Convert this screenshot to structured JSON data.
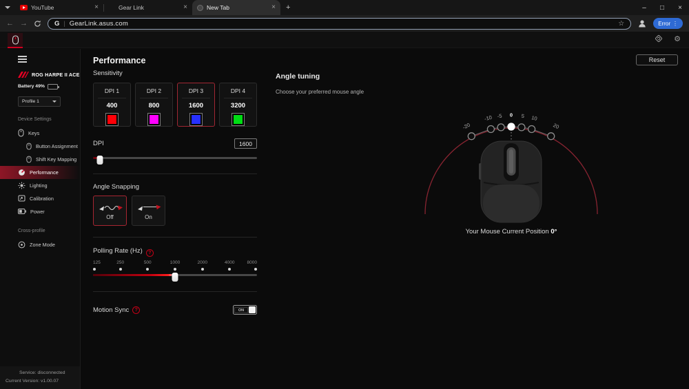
{
  "browser": {
    "tabs": [
      {
        "label": "YouTube"
      },
      {
        "label": "Gear Link"
      },
      {
        "label": "New Tab"
      }
    ],
    "url": "GearLink.asus.com",
    "url_favicon": "G",
    "error_label": "Error",
    "icons": {
      "back": "←",
      "forward": "→",
      "star": "☆",
      "more": "⋮",
      "new_tab": "+",
      "close_tab": "×",
      "minimize": "–",
      "maximize": "□",
      "close_window": "×"
    }
  },
  "app_header": {
    "icons": {
      "settings": "⚙"
    }
  },
  "sidebar": {
    "device_name": "ROG HARPE II ACE",
    "battery_label": "Battery 49%",
    "battery_level": "49%",
    "profile": "Profile 1",
    "section_device": "Device Settings",
    "section_cross": "Cross-profile",
    "items": {
      "keys": "Keys",
      "button_assignment": "Button Assignment",
      "shift_key_mapping": "Shift Key Mapping",
      "performance": "Performance",
      "lighting": "Lighting",
      "calibration": "Calibration",
      "power": "Power",
      "zone_mode": "Zone Mode"
    },
    "footer": {
      "service": "Service: disconnected",
      "version": "Current Version: v1.00.07"
    }
  },
  "performance": {
    "title": "Performance",
    "reset_label": "Reset",
    "sensitivity_label": "Sensitivity",
    "dpi_cards": [
      {
        "label": "DPI 1",
        "value": "400",
        "color": "#ff0008"
      },
      {
        "label": "DPI 2",
        "value": "800",
        "color": "#ff00ff"
      },
      {
        "label": "DPI 3",
        "value": "1600",
        "color": "#2730ff"
      },
      {
        "label": "DPI 4",
        "value": "3200",
        "color": "#00dc14"
      }
    ],
    "dpi_slider": {
      "label": "DPI",
      "value": "1600",
      "fill": "5%",
      "thumb": "4%"
    },
    "angle_snapping": {
      "label": "Angle Snapping",
      "off": "Off",
      "on": "On"
    },
    "polling": {
      "label": "Polling Rate (Hz)",
      "help": "?",
      "ticks": [
        "125",
        "250",
        "500",
        "1000",
        "2000",
        "4000",
        "8000"
      ],
      "fill": "50%",
      "thumb": "50%"
    },
    "motion_sync": {
      "label": "Motion Sync",
      "help": "?",
      "state": "ON"
    }
  },
  "angle_tuning": {
    "title": "Angle tuning",
    "subtitle": "Choose your preferred mouse angle",
    "ticks": [
      "-20",
      "-10",
      "-5",
      "0",
      "5",
      "10",
      "20"
    ],
    "caption": "Your Mouse Current Position",
    "value": "0°"
  }
}
